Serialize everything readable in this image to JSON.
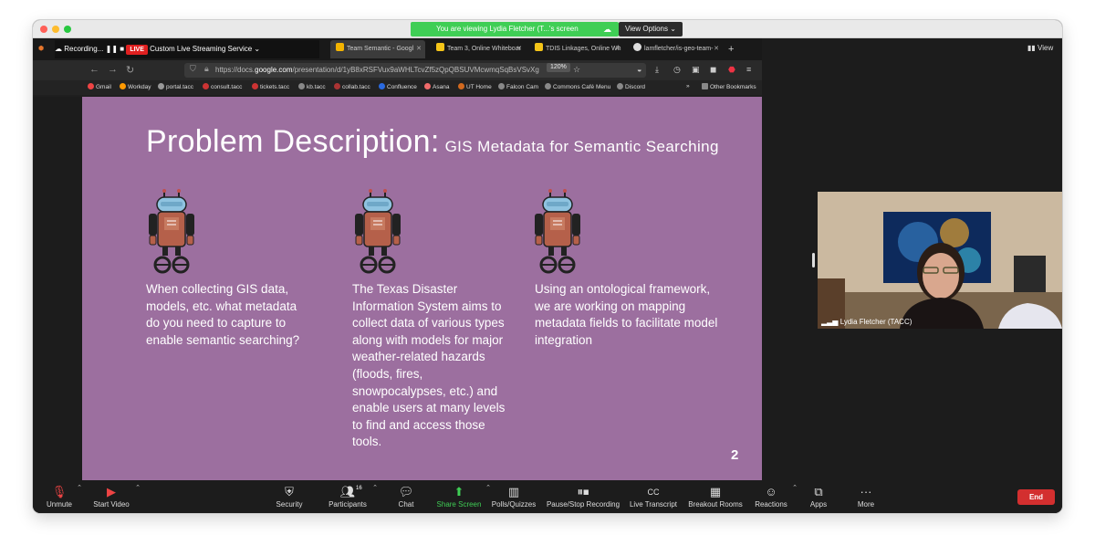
{
  "banner": {
    "text": "You are viewing Lydia Fletcher (T...'s screen",
    "options": "View Options"
  },
  "view_label": "View",
  "recording": {
    "label": "Recording...",
    "live": "LIVE",
    "service": "Custom Live Streaming Service"
  },
  "tabs": [
    {
      "title": "Team Semantic - Googl",
      "active": true
    },
    {
      "title": "Team 3, Online Whiteboar",
      "active": false
    },
    {
      "title": "TDIS Linkages, Online Wh",
      "active": false
    },
    {
      "title": "lamfletcher/is-geo-team-",
      "active": false
    }
  ],
  "url": {
    "prefix": "https://docs.",
    "domain": "google.com",
    "path": "/presentation/d/1yB8xRSFVux9aWHLTcvZf5zQpQBSUVMcwmqSqBsVSvXg",
    "zoom": "120%"
  },
  "bookmarks": [
    "Gmail",
    "Workday",
    "portal.tacc",
    "consult.tacc",
    "tickets.tacc",
    "kb.tacc",
    "collab.tacc",
    "Confluence",
    "Asana",
    "UT Home",
    "Falcon Cam",
    "Commons Café Menu",
    "Discord",
    "Other Bookmarks"
  ],
  "slide": {
    "title_main": "Problem Description:",
    "title_sub": "GIS Metadata for Semantic Searching",
    "columns": [
      "When collecting GIS data, models, etc. what metadata do you need to capture to enable semantic searching?",
      "The Texas Disaster Information System aims to collect data of various types along with models for major weather-related hazards (floods, fires, snowpocalypses, etc.) and enable users at many levels to find and access those tools.",
      "Using an ontological framework, we are working on mapping metadata fields to facilitate model integration"
    ],
    "page_number": "2",
    "background": "#9c6f9f"
  },
  "participant": {
    "name": "Lydia Fletcher (TACC)"
  },
  "toolbar": {
    "unmute": "Unmute",
    "start_video": "Start Video",
    "security": "Security",
    "participants": "Participants",
    "participants_count": "16",
    "chat": "Chat",
    "share_screen": "Share Screen",
    "polls": "Polls/Quizzes",
    "pause_stop": "Pause/Stop Recording",
    "transcript": "Live Transcript",
    "breakout": "Breakout Rooms",
    "reactions": "Reactions",
    "apps": "Apps",
    "more": "More",
    "end": "End"
  },
  "colors": {
    "share_green": "#3fce55",
    "end_red": "#d32f2f",
    "slide_purple": "#9c6f9f"
  }
}
